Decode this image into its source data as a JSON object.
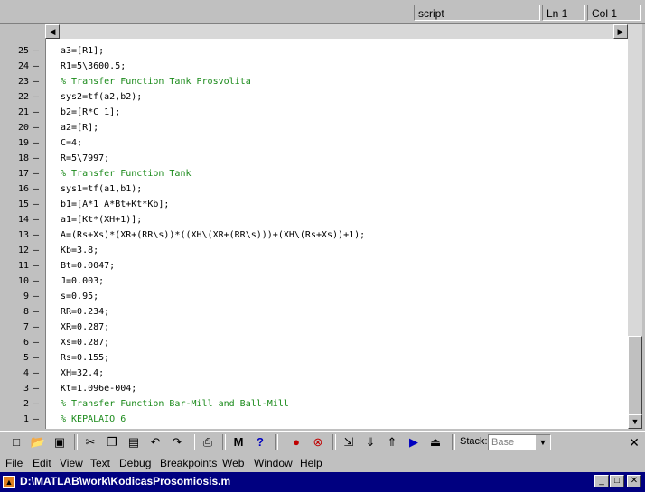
{
  "status": {
    "script": "script",
    "line": "Ln 1",
    "col": "Col 1"
  },
  "lines": [
    {
      "no": "25",
      "text": "a3=[R1];",
      "comment": false
    },
    {
      "no": "24",
      "text": "R1=5\\3600.5;",
      "comment": false
    },
    {
      "no": "23",
      "text": "% Transfer Function Tank Prosvolita",
      "comment": true
    },
    {
      "no": "22",
      "text": "sys2=tf(a2,b2);",
      "comment": false
    },
    {
      "no": "21",
      "text": "b2=[R*C 1];",
      "comment": false
    },
    {
      "no": "20",
      "text": "a2=[R];",
      "comment": false
    },
    {
      "no": "19",
      "text": "C=4;",
      "comment": false
    },
    {
      "no": "18",
      "text": "R=5\\7997;",
      "comment": false
    },
    {
      "no": "17",
      "text": "% Transfer Function Tank",
      "comment": true
    },
    {
      "no": "16",
      "text": "sys1=tf(a1,b1);",
      "comment": false
    },
    {
      "no": "15",
      "text": "b1=[A*1 A*Bt+Kt*Kb];",
      "comment": false
    },
    {
      "no": "14",
      "text": "a1=[Kt*(XH+1)];",
      "comment": false
    },
    {
      "no": "13",
      "text": "A=(Rs+Xs)*(XR+(RR\\s))*((XH\\(XR+(RR\\s)))+(XH\\(Rs+Xs))+1);",
      "comment": false
    },
    {
      "no": "12",
      "text": "Kb=3.8;",
      "comment": false
    },
    {
      "no": "11",
      "text": "Bt=0.0047;",
      "comment": false
    },
    {
      "no": "10",
      "text": "J=0.003;",
      "comment": false
    },
    {
      "no": "9",
      "text": "s=0.95;",
      "comment": false
    },
    {
      "no": "8",
      "text": "RR=0.234;",
      "comment": false
    },
    {
      "no": "7",
      "text": "XR=0.287;",
      "comment": false
    },
    {
      "no": "6",
      "text": "Xs=0.287;",
      "comment": false
    },
    {
      "no": "5",
      "text": "Rs=0.155;",
      "comment": false
    },
    {
      "no": "4",
      "text": "XH=32.4;",
      "comment": false
    },
    {
      "no": "3",
      "text": "Kt=1.096e-004;",
      "comment": false
    },
    {
      "no": "2",
      "text": "% Transfer Function Bar-Mill and Ball-Mill",
      "comment": true
    },
    {
      "no": "1",
      "text": "% KEPALAIO 6",
      "comment": true
    }
  ],
  "toolbar": {
    "stack_label": "Stack:",
    "stack_value": "Base"
  },
  "menu": [
    "File",
    "Edit",
    "View",
    "Text",
    "Debug",
    "Breakpoints",
    "Web",
    "Window",
    "Help"
  ],
  "title": "D:\\MATLAB\\work\\KodicasProsomiosis.m",
  "icons": {
    "new": "new-file-icon",
    "open": "open-icon",
    "save": "save-icon",
    "cut": "cut-icon",
    "copy": "copy-icon",
    "paste": "paste-icon",
    "undo": "undo-icon",
    "redo": "redo-icon",
    "print": "print-icon",
    "find": "find-icon",
    "help": "help-icon"
  }
}
